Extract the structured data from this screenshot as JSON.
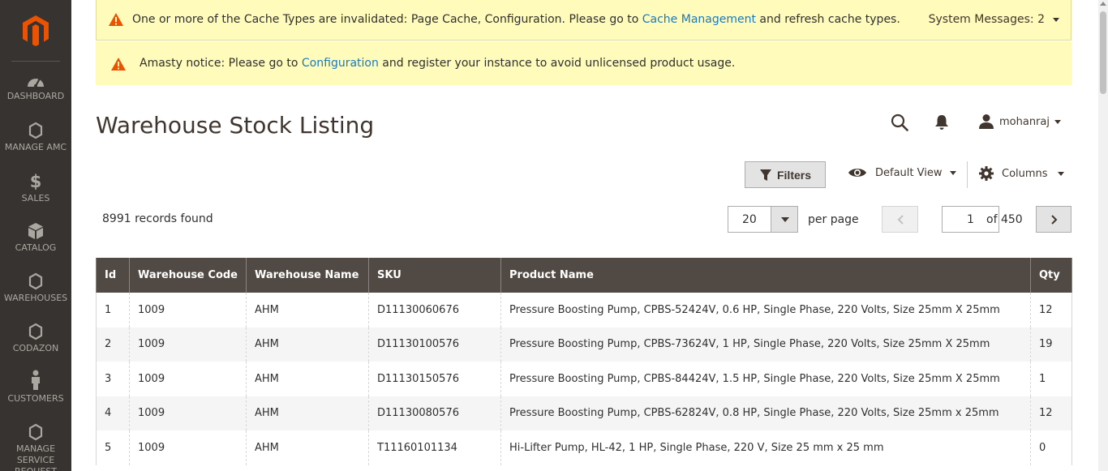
{
  "sidebar": {
    "items": [
      {
        "label": "DASHBOARD",
        "icon": "dashboard-icon"
      },
      {
        "label": "MANAGE AMC",
        "icon": "hexagon-icon"
      },
      {
        "label": "SALES",
        "icon": "dollar-icon"
      },
      {
        "label": "CATALOG",
        "icon": "box-icon"
      },
      {
        "label": "WAREHOUSES",
        "icon": "hexagon-icon"
      },
      {
        "label": "CODAZON",
        "icon": "hexagon-icon"
      },
      {
        "label": "CUSTOMERS",
        "icon": "person-icon"
      },
      {
        "label": "MANAGE SERVICE REQUEST",
        "icon": "hexagon-icon"
      }
    ]
  },
  "messages": {
    "cache": {
      "before": "One or more of the Cache Types are invalidated: Page Cache, Configuration. Please go to ",
      "link": "Cache Management",
      "after": " and refresh cache types."
    },
    "system_messages": "System Messages: 2",
    "amasty": {
      "before": "Amasty notice: Please go to ",
      "link": "Configuration",
      "after": " and register your instance to avoid unlicensed product usage."
    }
  },
  "header": {
    "title": "Warehouse Stock Listing",
    "username": "mohanraj"
  },
  "toolbar": {
    "filters_label": "Filters",
    "view_label": "Default View",
    "columns_label": "Columns",
    "records_found": "8991 records found",
    "per_page_value": "20",
    "per_page_label": "per page",
    "current_page": "1",
    "total_pages_label": "of 450"
  },
  "grid": {
    "columns": [
      "Id",
      "Warehouse Code",
      "Warehouse Name",
      "SKU",
      "Product Name",
      "Qty"
    ],
    "rows": [
      [
        "1",
        "1009",
        "AHM",
        "D11130060676",
        "Pressure Boosting Pump, CPBS-52424V, 0.6 HP, Single Phase, 220 Volts, Size 25mm X 25mm",
        "12"
      ],
      [
        "2",
        "1009",
        "AHM",
        "D11130100576",
        "Pressure Boosting Pump, CPBS-73624V, 1 HP, Single Phase, 220 Volts, Size 25mm X 25mm",
        "19"
      ],
      [
        "3",
        "1009",
        "AHM",
        "D11130150576",
        "Pressure Boosting Pump, CPBS-84424V, 1.5 HP, Single Phase, 220 Volts, Size 25mm X 25mm",
        "1"
      ],
      [
        "4",
        "1009",
        "AHM",
        "D11130080576",
        "Pressure Boosting Pump, CPBS-62824V, 0.8 HP, Single Phase, 220 Volts, Size 25mm x 25mm",
        "12"
      ],
      [
        "5",
        "1009",
        "AHM",
        "T11160101134",
        "Hi-Lifter Pump, HL-42, 1 HP, Single Phase, 220 V, Size 25 mm x 25 mm",
        "0"
      ]
    ]
  },
  "colors": {
    "sidebar_bg": "#373330",
    "message_bg": "#fffbbb",
    "header_bg": "#514943",
    "link": "#1979c3",
    "warning": "#eb5202"
  }
}
